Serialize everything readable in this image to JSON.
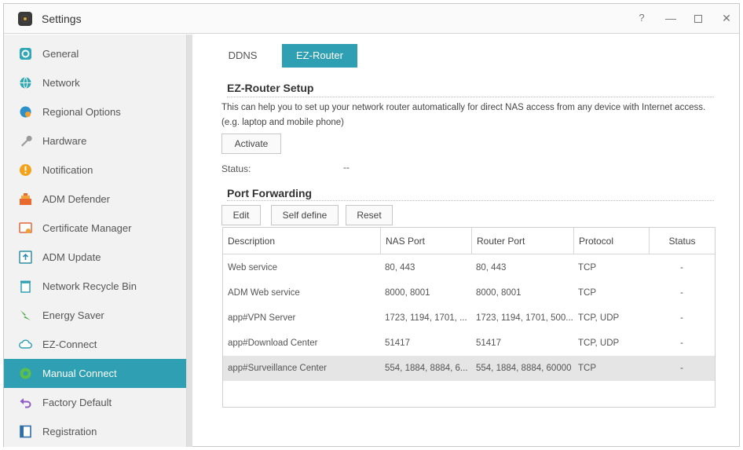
{
  "window": {
    "title": "Settings",
    "controls": {
      "help": "?",
      "minimize": "—",
      "close": "✕"
    }
  },
  "sidebar": {
    "items": [
      {
        "label": "General",
        "icon": "general-icon"
      },
      {
        "label": "Network",
        "icon": "network-globe-icon"
      },
      {
        "label": "Regional Options",
        "icon": "regional-options-icon"
      },
      {
        "label": "Hardware",
        "icon": "hardware-wrench-icon"
      },
      {
        "label": "Notification",
        "icon": "notification-icon"
      },
      {
        "label": "ADM Defender",
        "icon": "adm-defender-icon"
      },
      {
        "label": "Certificate Manager",
        "icon": "certificate-icon"
      },
      {
        "label": "ADM Update",
        "icon": "adm-update-icon"
      },
      {
        "label": "Network Recycle Bin",
        "icon": "recycle-bin-icon"
      },
      {
        "label": "Energy Saver",
        "icon": "energy-saver-icon"
      },
      {
        "label": "EZ-Connect",
        "icon": "ez-connect-cloud-icon"
      },
      {
        "label": "Manual Connect",
        "icon": "manual-connect-icon"
      },
      {
        "label": "Factory Default",
        "icon": "factory-default-icon"
      },
      {
        "label": "Registration",
        "icon": "registration-icon"
      }
    ],
    "active_item": "Manual Connect"
  },
  "tabs": [
    {
      "label": "DDNS"
    },
    {
      "label": "EZ-Router"
    }
  ],
  "active_tab": "EZ-Router",
  "ez_router": {
    "title": "EZ-Router Setup",
    "description": "This can help you to set up your network router automatically for direct NAS access from any device with Internet access. (e.g. laptop and mobile phone)",
    "activate_label": "Activate",
    "status_label": "Status:",
    "status_value": "--"
  },
  "port_forwarding": {
    "title": "Port Forwarding",
    "buttons": {
      "edit": "Edit",
      "self_define": "Self define",
      "reset": "Reset"
    },
    "columns": [
      "Description",
      "NAS Port",
      "Router Port",
      "Protocol",
      "Status"
    ],
    "rows": [
      {
        "description": "Web service",
        "nas_port": "80, 443",
        "router_port": "80, 443",
        "protocol": "TCP",
        "status": "-"
      },
      {
        "description": "ADM Web service",
        "nas_port": "8000, 8001",
        "router_port": "8000, 8001",
        "protocol": "TCP",
        "status": "-"
      },
      {
        "description": "app#VPN Server",
        "nas_port": "1723, 1194, 1701, ...",
        "router_port": "1723, 1194, 1701, 500...",
        "protocol": "TCP, UDP",
        "status": "-"
      },
      {
        "description": "app#Download Center",
        "nas_port": "51417",
        "router_port": "51417",
        "protocol": "TCP, UDP",
        "status": "-"
      },
      {
        "description": "app#Surveillance Center",
        "nas_port": "554, 1884, 8884, 6...",
        "router_port": "554, 1884, 8884, 60000",
        "protocol": "TCP",
        "status": "-"
      }
    ],
    "selected_row": 4
  },
  "colors": {
    "accent": "#2f9fb3",
    "sidebar_bg": "#f2f2f2",
    "selected_row_bg": "#e5e5e5"
  }
}
